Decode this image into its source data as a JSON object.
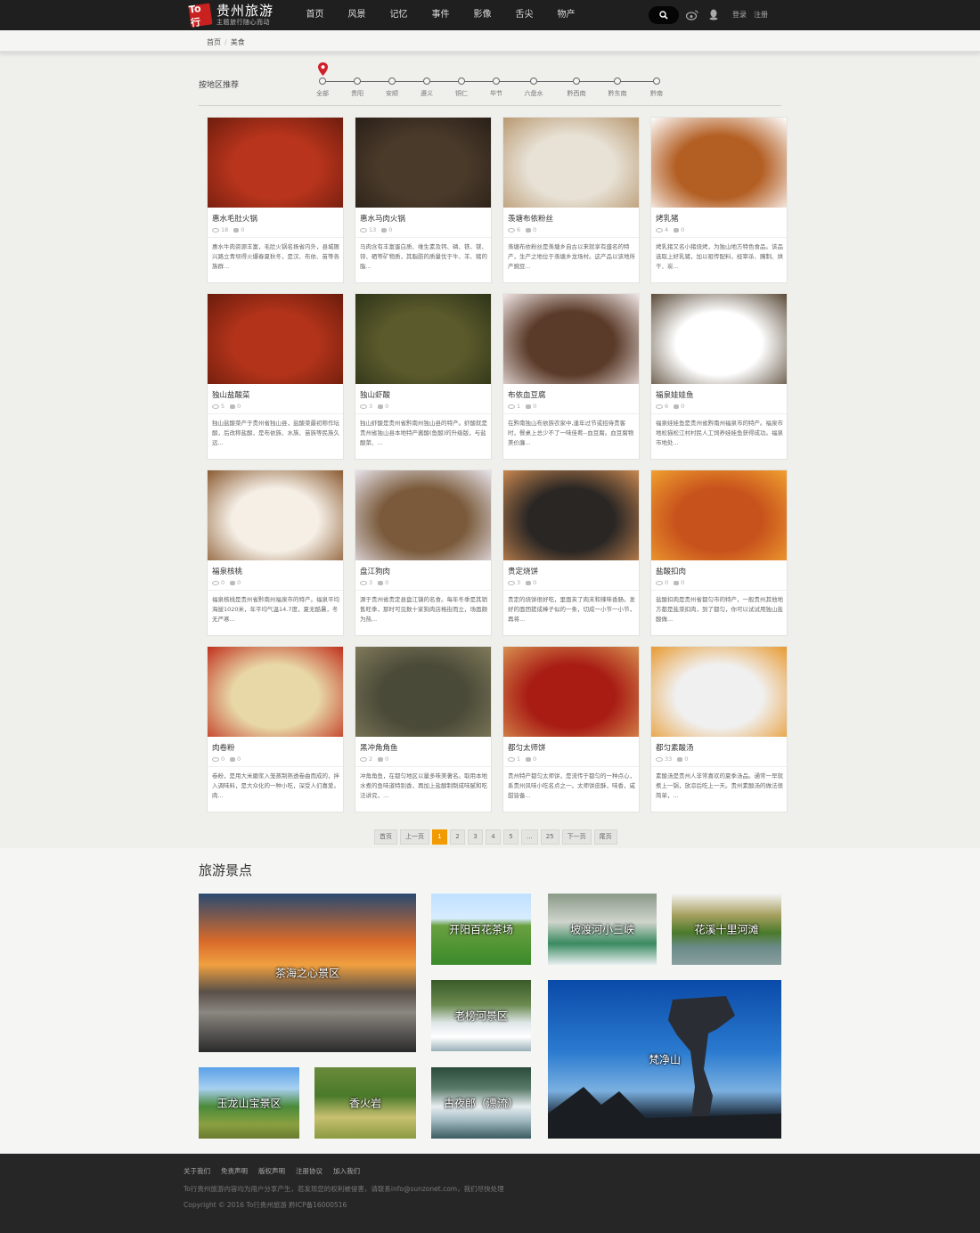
{
  "header": {
    "logo_mark": "To行",
    "logo_title": "贵州旅游",
    "logo_subtitle": "主题旅行随心而动",
    "nav": [
      "首页",
      "风景",
      "记忆",
      "事件",
      "影像",
      "舌尖",
      "物产"
    ],
    "search_icon": "search-icon",
    "login": "登录",
    "register": "注册"
  },
  "breadcrumb": [
    "首页",
    "美食"
  ],
  "region": {
    "label": "按地区推荐",
    "items": [
      "全部",
      "贵阳",
      "安顺",
      "遵义",
      "铜仁",
      "毕节",
      "六盘水",
      "黔西南",
      "黔东南",
      "黔南"
    ]
  },
  "foods": [
    {
      "name": "惠水毛肚火锅",
      "views": "18",
      "comments": "0",
      "desc": "惠水牛肉资源丰富，毛肚火锅名扬省内外，县城匯兴路立青坝得火爆春夏秋冬，是汉、布依、苗等各族群...",
      "color": "#b8341c",
      "color2": "#6e1d0e"
    },
    {
      "name": "惠水马肉火锅",
      "views": "13",
      "comments": "0",
      "desc": "马肉含有丰富蛋白质、维生素及钙、磷、铁、镁、锌、硒等矿物质，其脂肪的质量优于牛、羊、猪的脂...",
      "color": "#4a3a2a",
      "color2": "#2a2018"
    },
    {
      "name": "羡塘布依粉丝",
      "views": "6",
      "comments": "0",
      "desc": "羡塘布依粉丝是羡塘乡自古以来就享有盛名的特产，生产之地位于羡塘乡龙场村。这产品以该地所产豌豆...",
      "color": "#e8e2d6",
      "color2": "#b89870"
    },
    {
      "name": "烤乳猪",
      "views": "4",
      "comments": "0",
      "desc": "烤乳猪又名小猪烧烤，为独山地方特色食品。该品选取上好乳猪，加以祖传配料，经宰杀、腌制、烘干、炭...",
      "color": "#b35f24",
      "color2": "#ffffff"
    },
    {
      "name": "独山盐酸菜",
      "views": "5",
      "comments": "0",
      "desc": "独山盐酸菜产于贵州省独山县，盐酸菜最初称作坛酸，后改称盐酸，是布依族、水族、苗族等民族久远...",
      "color": "#b2331a",
      "color2": "#6a1c0c"
    },
    {
      "name": "独山虾酸",
      "views": "3",
      "comments": "0",
      "desc": "独山虾酸是贵州省黔南州独山县的特产。虾酸就是贵州省独山县本地特产酱酸(鱼酸)的升级版，与盐酸菜、...",
      "color": "#5b5a2c",
      "color2": "#2e3418"
    },
    {
      "name": "布依血豆腐",
      "views": "1",
      "comments": "0",
      "desc": "在黔南独山布依族农家中,逢年过节或招待贵客时，餐桌上总少不了一味佳肴--血豆腐。血豆腐物美价廉...",
      "color": "#5a3a28",
      "color2": "#f0e6e6"
    },
    {
      "name": "福泉娃娃鱼",
      "views": "6",
      "comments": "0",
      "desc": "福泉娃娃鱼是贵州省黔南州福泉市的特产。福泉市地松猫松江村村民人工饲养娃娃鱼获得成功。福泉市地处...",
      "color": "#ffffff",
      "color2": "#5a4a38"
    },
    {
      "name": "福泉核桃",
      "views": "0",
      "comments": "0",
      "desc": "福泉核桃是贵州省黔南州福泉市的特产。福泉平均海拔1020米，年平均气温14.7度，夏无酷暑，冬无严寒...",
      "color": "#f5efe6",
      "color2": "#8a5a30"
    },
    {
      "name": "盘江狗肉",
      "views": "3",
      "comments": "0",
      "desc": "源于贵州省贵定县盘江镇的名食。每年冬季是其销售旺季，那时可见数十家狗肉店格街而立，场面颇为热...",
      "color": "#7a5a3a",
      "color2": "#e8e4ec"
    },
    {
      "name": "贵定烧饼",
      "views": "3",
      "comments": "0",
      "desc": "贵定的烧饼很好吃，里面夹了肉末和辣味香肠。发好的面团搓成棒子似的一条，切成一小节一小节，再将...",
      "color": "#2a2624",
      "color2": "#c98850"
    },
    {
      "name": "盐酸扣肉",
      "views": "0",
      "comments": "0",
      "desc": "盐酸扣肉是贵州省都匀市的特产，一般贵州其他地方都是盐菜扣肉，到了都匀，你可以试试用独山盐酸做...",
      "color": "#c8521c",
      "color2": "#f0a030"
    },
    {
      "name": "肉卷粉",
      "views": "0",
      "comments": "0",
      "desc": "卷粉，是用大米磨浆入笼蒸制熟透卷曲而成的，拌入调味料，是大众化的一种小吃，深受人们喜爱。肉...",
      "color": "#e8d8a8",
      "color2": "#c0301c"
    },
    {
      "name": "黑冲角角鱼",
      "views": "2",
      "comments": "0",
      "desc": "冲角角鱼，在都匀地区以量多味美著名。取用本地水煮的鱼味道特别香，再加上盐酸制制成味腻和吃法讲究，...",
      "color": "#4a4a38",
      "color2": "#807a5a"
    },
    {
      "name": "都匀太师饼",
      "views": "1",
      "comments": "0",
      "desc": "贵州特产都匀太师饼，是流传于都匀的一种点心，系贵州风味小吃名点之一。太师饼皮酥，味香，咸甜皆备...",
      "color": "#a81c14",
      "color2": "#d89050"
    },
    {
      "name": "都匀素酸汤",
      "views": "33",
      "comments": "0",
      "desc": "素酸汤是贵州人非常喜欢的夏季汤品。通常一早就煮上一锅，放凉后吃上一天。贵州素酸汤的做法很简单，...",
      "color": "#f0f0f0",
      "color2": "#e89a30"
    }
  ],
  "pagination": [
    "首页",
    "上一页",
    "1",
    "2",
    "3",
    "4",
    "5",
    "...",
    "25",
    "下一页",
    "尾页"
  ],
  "pagination_current": "1",
  "spots": {
    "title": "旅游景点",
    "items": [
      "茶海之心景区",
      "开阳百花茶场",
      "坡渡河小三峡",
      "花溪十里河滩",
      "老榜河景区",
      "梵净山",
      "玉龙山宝景区",
      "香火岩",
      "古夜郎（漂流）"
    ]
  },
  "footer": {
    "links": [
      "关于我们",
      "免责声明",
      "版权声明",
      "注册协议",
      "加入我们"
    ],
    "notice": "To行贵州旅游内容均为用户分享产生，若发现您的权利被侵害，请联系info@sunzonet.com，我们尽快处理",
    "copyright": "Copyright © 2016 To行贵州旅游 黔ICP备16000516"
  },
  "colors": {
    "accent": "#f29b00",
    "header_bg": "#1f1f1f",
    "logo_red": "#c9211f",
    "pin_red": "#d0202a",
    "footer_bg": "#262626"
  }
}
